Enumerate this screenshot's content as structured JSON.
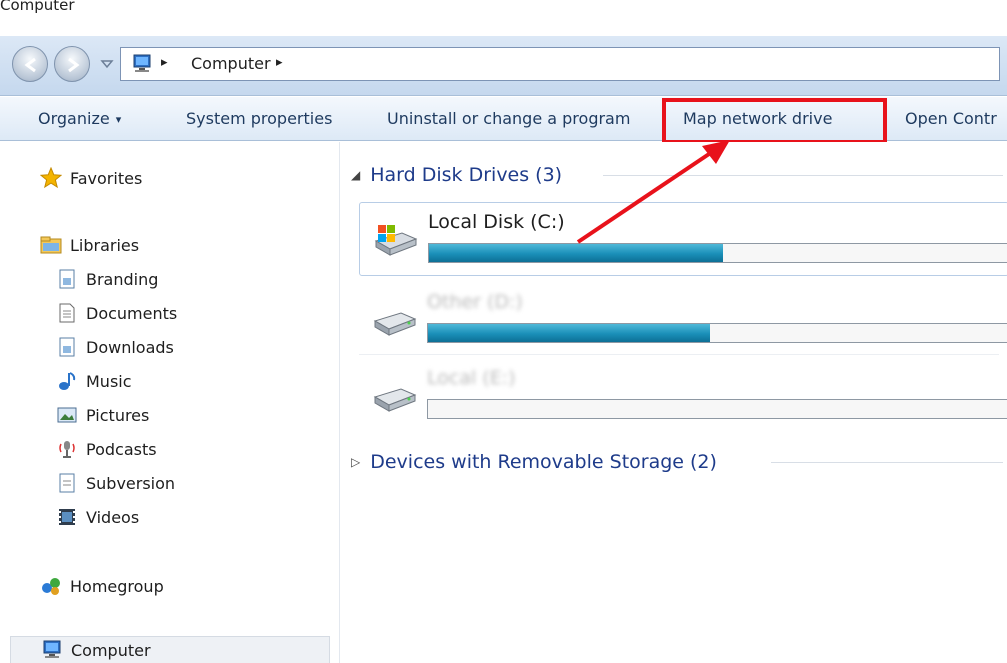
{
  "window": {
    "title": "Computer"
  },
  "address": {
    "crumb": "Computer",
    "sep": "▸"
  },
  "toolbar": {
    "organize": "Organize",
    "organize_caret": "▾",
    "system_properties": "System properties",
    "uninstall": "Uninstall or change a program",
    "map_drive": "Map network drive",
    "control_panel": "Open Contr"
  },
  "nav": {
    "favorites": "Favorites",
    "libraries": "Libraries",
    "library_items": [
      "Branding",
      "Documents",
      "Downloads",
      "Music",
      "Pictures",
      "Podcasts",
      "Subversion",
      "Videos"
    ],
    "homegroup": "Homegroup",
    "computer": "Computer"
  },
  "content": {
    "hard_disk_group": "Hard Disk Drives (3)",
    "removable_group": "Devices with Removable Storage (2)",
    "drives": [
      {
        "name": "Local Disk (C:)",
        "fill_percent": 50
      },
      {
        "name": "Other (D:)",
        "fill_percent": 48
      },
      {
        "name": "Local (E:)",
        "fill_percent": 0
      }
    ]
  },
  "colors": {
    "highlight": "#e8121b",
    "group_text": "#1e3b8a",
    "bar_fill": "#1a8fb8"
  }
}
